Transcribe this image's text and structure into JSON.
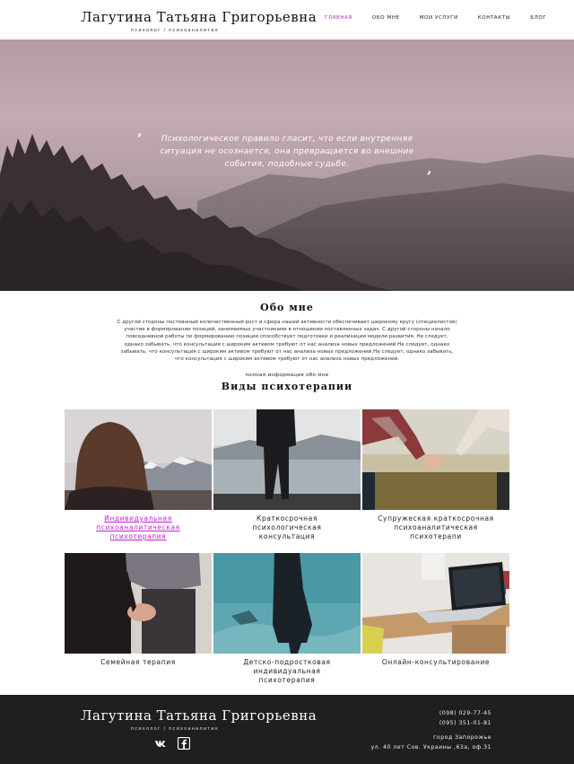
{
  "brand": {
    "name": "Лагутина Татьяна Григорьевна",
    "subtitle": "психолог / психоаналитик"
  },
  "nav": {
    "items": [
      "Главная",
      "Обо мне",
      "Мои услуги",
      "Контакты",
      "Блог"
    ],
    "active_index": 0
  },
  "hero": {
    "quote": "Психологическое правило гласит, что если внутренняя ситуация не осознается, она превращается во внешние события, подобные судьбе.",
    "open_mark": "‚",
    "close_mark": "‚"
  },
  "about": {
    "title": "Обо мне",
    "text": "С другой стороны постоянный количественный рост и сфера нашей активности обеспечивает широкому кругу (специалистов) участие в формировании позиций, занимаемых участниками в отношении поставленных задач. С другой стороны начало повседневной работы по формированию позиции способствует подготовки и реализации модели развития. Не следует, однако забывать, что консультация с широким активом требуют от нас анализа новых предложений.Не следует, однако забывать, что консультация с широким активом требуют от нас анализа новых предложений.Не следует, однако забывать, что консультация с широким активом требуют от нас анализа новых предложений.",
    "more_link": "полная информация обо мне"
  },
  "therapies": {
    "title": "Виды психотерапии",
    "items": [
      {
        "label": "Индивидуальная психоаналитическая психотерапия",
        "highlight": true,
        "image": "woman-mountains-photo"
      },
      {
        "label": "Краткосрочная психологическая консультация",
        "highlight": false,
        "image": "man-lake-fog-photo"
      },
      {
        "label": "Супружеская краткосрочная психоаналитическая психотерапи",
        "highlight": false,
        "image": "holding-hands-photo"
      },
      {
        "label": "Семейная терапия",
        "highlight": false,
        "image": "couple-hands-photo"
      },
      {
        "label": "Детско-подростковая индивидуальная психотерапия",
        "highlight": false,
        "image": "girl-aquarium-photo"
      },
      {
        "label": "Онлайн-консультирование",
        "highlight": false,
        "image": "laptop-desk-photo"
      }
    ]
  },
  "footer": {
    "name": "Лагутина Татьяна Григорьевна",
    "subtitle": "психолог / психоаналитик",
    "phone1": "(098) 029-77-45",
    "phone2": "(095) 351-01-81",
    "city": "город Запорожье",
    "address": "ул. 40 лет Сов. Украины ,63а, оф.31",
    "social": [
      "vk-icon",
      "facebook-icon"
    ]
  },
  "colors": {
    "accent": "#c41fd4",
    "footer_bg": "#1f1f22"
  }
}
